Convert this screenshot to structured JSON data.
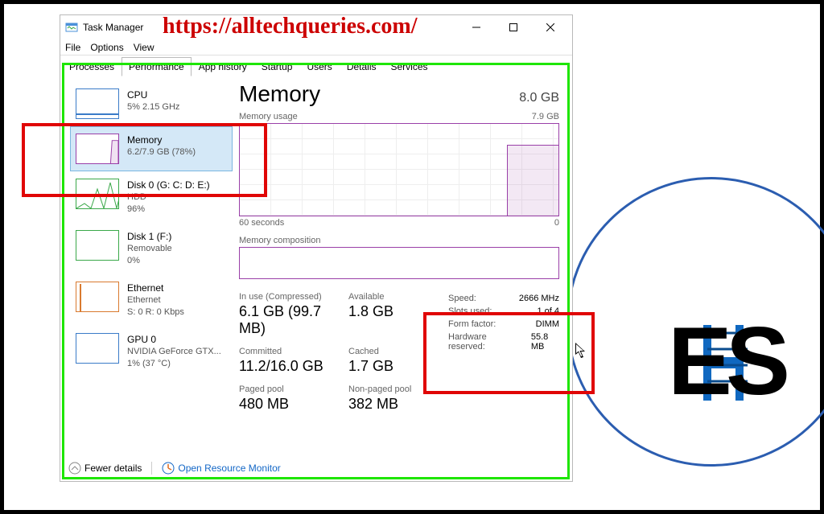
{
  "watermark": "https://alltechqueries.com/",
  "window": {
    "title": "Task Manager"
  },
  "menu": {
    "file": "File",
    "options": "Options",
    "view": "View"
  },
  "tabs": {
    "processes": "Processes",
    "performance": "Performance",
    "app_history": "App history",
    "startup": "Startup",
    "users": "Users",
    "details": "Details",
    "services": "Services"
  },
  "sidebar": {
    "items": [
      {
        "title": "CPU",
        "sub": "5% 2.15 GHz"
      },
      {
        "title": "Memory",
        "sub": "6.2/7.9 GB (78%)"
      },
      {
        "title": "Disk 0 (G: C: D: E:)",
        "sub1": "HDD",
        "sub2": "96%"
      },
      {
        "title": "Disk 1 (F:)",
        "sub1": "Removable",
        "sub2": "0%"
      },
      {
        "title": "Ethernet",
        "sub1": "Ethernet",
        "sub2": "S: 0 R: 0 Kbps"
      },
      {
        "title": "GPU 0",
        "sub1": "NVIDIA GeForce GTX...",
        "sub2": "1% (37 °C)"
      }
    ]
  },
  "main": {
    "title": "Memory",
    "capacity": "8.0 GB",
    "usage_label": "Memory usage",
    "usage_max": "7.9 GB",
    "axis_left": "60 seconds",
    "axis_right": "0",
    "composition_label": "Memory composition",
    "stats": {
      "in_use_label": "In use (Compressed)",
      "in_use": "6.1 GB (99.7 MB)",
      "available_label": "Available",
      "available": "1.8 GB",
      "committed_label": "Committed",
      "committed": "11.2/16.0 GB",
      "cached_label": "Cached",
      "cached": "1.7 GB",
      "paged_label": "Paged pool",
      "paged": "480 MB",
      "nonpaged_label": "Non-paged pool",
      "nonpaged": "382 MB"
    },
    "right_stats": {
      "speed_label": "Speed:",
      "speed": "2666 MHz",
      "slots_label": "Slots used:",
      "slots": "1 of 4",
      "form_label": "Form factor:",
      "form": "DIMM",
      "hw_label": "Hardware reserved:",
      "hw": "55.8 MB"
    }
  },
  "footer": {
    "fewer": "Fewer details",
    "orm": "Open Resource Monitor"
  },
  "chart_data": {
    "type": "line",
    "title": "Memory usage",
    "xlabel": "seconds",
    "ylabel": "GB",
    "xlim": [
      0,
      60
    ],
    "ylim": [
      0,
      7.9
    ],
    "x": [
      60,
      50,
      40,
      30,
      20,
      11,
      10,
      9,
      8,
      7,
      6,
      5,
      4,
      3,
      2,
      1,
      0
    ],
    "values": [
      0,
      0,
      0,
      0,
      0,
      0,
      6.0,
      6.0,
      6.0,
      6.0,
      6.1,
      6.1,
      6.1,
      6.1,
      6.2,
      6.2,
      6.2
    ]
  }
}
